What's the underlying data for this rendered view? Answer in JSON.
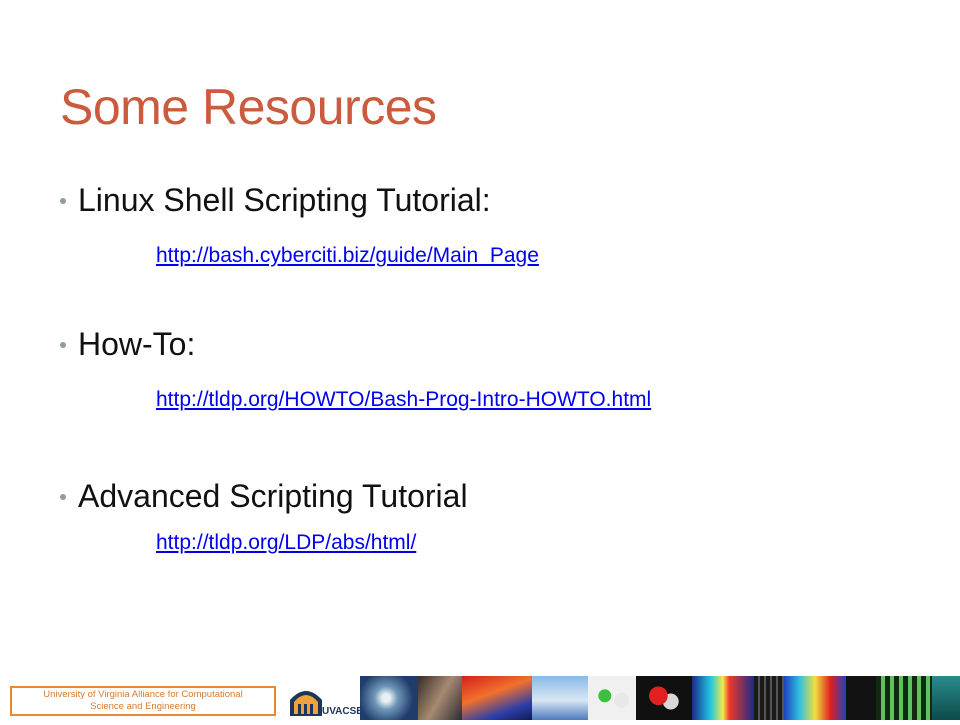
{
  "slide": {
    "title": "Some Resources",
    "items": [
      {
        "label": "Linux Shell Scripting Tutorial:",
        "url": "http://bash.cyberciti.biz/guide/Main_Page"
      },
      {
        "label": "How-To:",
        "url": "http://tldp.org/HOWTO/Bash-Prog-Intro-HOWTO.html"
      },
      {
        "label": "Advanced Scripting Tutorial",
        "url": "http://tldp.org/LDP/abs/html/"
      }
    ]
  },
  "footer": {
    "org_line1": "University of Virginia Alliance for Computational",
    "org_line2": "Science and Engineering",
    "logo_text": "UVACSE"
  },
  "colors": {
    "title": "#cc5a3c",
    "link": "#0000ee",
    "footer_border": "#e8893a"
  }
}
